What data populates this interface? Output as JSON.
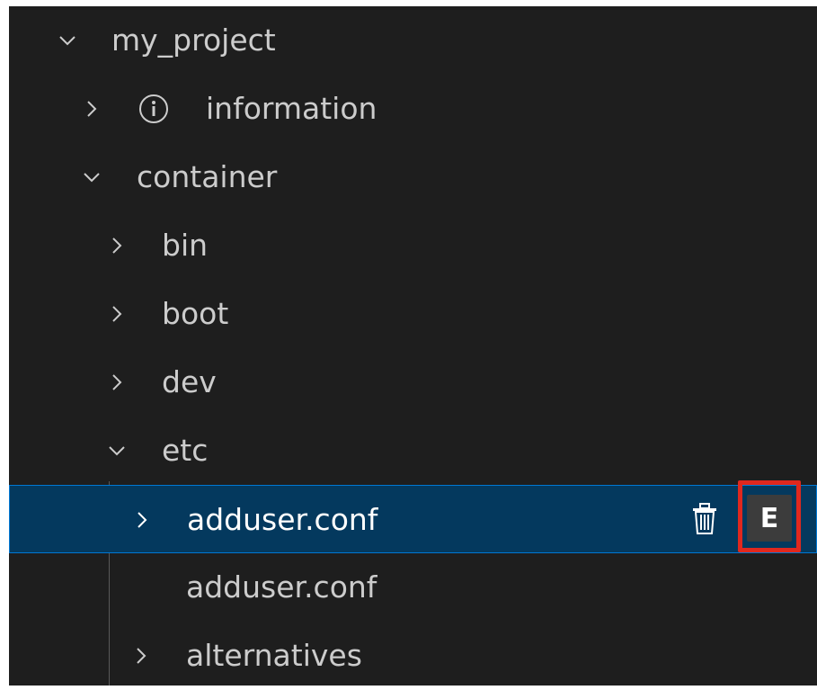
{
  "tree": {
    "project": {
      "label": "my_project",
      "expanded": true
    },
    "information": {
      "label": "information",
      "icon": "info-icon"
    },
    "container": {
      "label": "container",
      "expanded": true
    },
    "bin": {
      "label": "bin"
    },
    "boot": {
      "label": "boot"
    },
    "dev": {
      "label": "dev"
    },
    "etc": {
      "label": "etc",
      "expanded": true
    },
    "adduser_folder": {
      "label": "adduser.conf",
      "selected": true
    },
    "adduser_file": {
      "label": "adduser.conf"
    },
    "alternatives": {
      "label": "alternatives"
    }
  },
  "actions": {
    "delete_icon": "trash-icon",
    "edit_label": "E"
  },
  "colors": {
    "background": "#1e1e1e",
    "text": "#cccccc",
    "selection_bg": "#04395e",
    "selection_border": "#0078d4",
    "highlight": "#e0281e"
  }
}
